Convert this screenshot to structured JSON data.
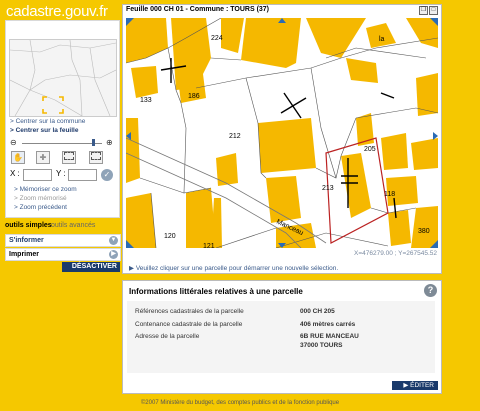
{
  "site": {
    "logo": "cadastre.gouv.fr"
  },
  "left_panel": {
    "links": {
      "center_commune": "> Centrer sur la commune",
      "center_feuille": "> Centrer sur la feuille"
    },
    "coords": {
      "x_label": "X :",
      "y_label": "Y :",
      "x_value": "",
      "y_value": ""
    },
    "memory": {
      "memorize": "> Mémoriser ce zoom",
      "memorized": "> Zoom mémorisé",
      "previous": "> Zoom précédent"
    },
    "tabs": {
      "simple": "outils simples",
      "advanced": "outils avancés"
    },
    "sections": {
      "inform": "S'informer",
      "print": "Imprimer"
    },
    "deactivate": "DÉSACTIVER"
  },
  "map": {
    "title": "Feuille 000 CH 01 - Commune : TOURS (37)",
    "coords": "X=476279.00 ; Y=267545.52",
    "hint": "Veuillez cliquer sur une parcelle pour démarrer une nouvelle sélection.",
    "parcel_numbers": [
      "224",
      "133",
      "186",
      "212",
      "205",
      "213",
      "118",
      "120",
      "121",
      "380"
    ],
    "street_labels": [
      "la",
      "Manceau"
    ]
  },
  "info": {
    "title": "Informations littérales relatives à une parcelle",
    "rows": [
      {
        "label": "Références cadastrales de la parcelle",
        "value": "000 CH 205"
      },
      {
        "label": "Contenance cadastrale de la parcelle",
        "value": "406 mètres carrés"
      },
      {
        "label": "Adresse de la parcelle",
        "value": "6B RUE MANCEAU"
      },
      {
        "label": "",
        "value": "37000 TOURS"
      }
    ],
    "edit": "ÉDITER"
  },
  "footer": "©2007 Ministère du budget, des comptes publics et de la fonction publique"
}
